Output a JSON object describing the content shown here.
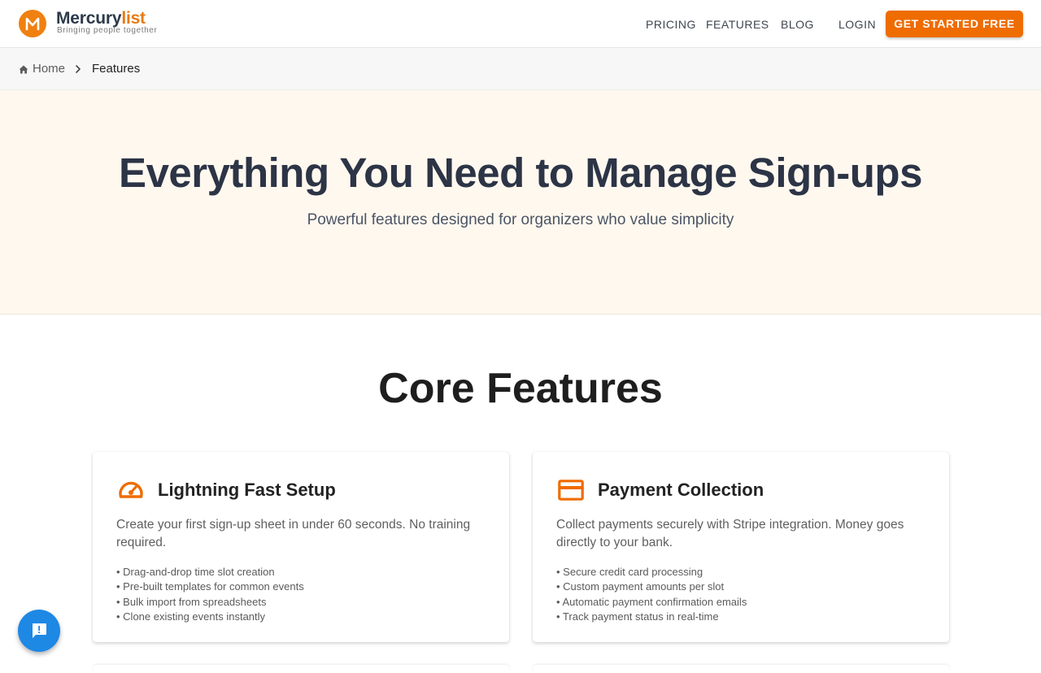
{
  "brand": {
    "name_main": "Mercury",
    "name_accent": "list",
    "tagline": "Bringing people together",
    "logo_letter": "M",
    "accent_color": "#ef6c00"
  },
  "nav": {
    "pricing": "PRICING",
    "features": "FEATURES",
    "blog": "BLOG",
    "login": "LOGIN",
    "cta": "GET STARTED FREE"
  },
  "breadcrumb": {
    "home": "Home",
    "current": "Features",
    "home_icon": "home-icon",
    "separator_icon": "chevron-right-icon"
  },
  "hero": {
    "title": "Everything You Need to Manage Sign-ups",
    "subtitle": "Powerful features designed for organizers who value simplicity"
  },
  "section": {
    "title": "Core Features"
  },
  "features": [
    {
      "icon": "speedometer-icon",
      "title": "Lightning Fast Setup",
      "description": "Create your first sign-up sheet in under 60 seconds. No training required.",
      "bullets": [
        "• Drag-and-drop time slot creation",
        "• Pre-built templates for common events",
        "• Bulk import from spreadsheets",
        "• Clone existing events instantly"
      ]
    },
    {
      "icon": "credit-card-icon",
      "title": "Payment Collection",
      "description": "Collect payments securely with Stripe integration. Money goes directly to your bank.",
      "bullets": [
        "• Secure credit card processing",
        "• Custom payment amounts per slot",
        "• Automatic payment confirmation emails",
        "• Track payment status in real-time"
      ]
    }
  ],
  "chat": {
    "icon": "feedback-icon",
    "color": "#1e88e5"
  }
}
